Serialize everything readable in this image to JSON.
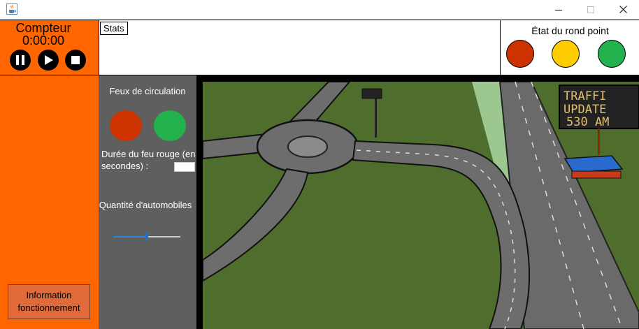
{
  "window": {
    "icon": "java-cup-icon",
    "controls": [
      "minimize-icon",
      "maximize-icon",
      "close-icon"
    ]
  },
  "counter": {
    "title": "Compteur",
    "time": "0:00:00",
    "buttons": [
      "pause-icon",
      "play-icon",
      "stop-icon"
    ]
  },
  "stats": {
    "tab_label": "Stats"
  },
  "roundabout_state": {
    "title": "État du rond point",
    "lights": [
      {
        "name": "red",
        "color": "#cc3300"
      },
      {
        "name": "yellow",
        "color": "#ffcc00"
      },
      {
        "name": "green",
        "color": "#22b14c"
      }
    ]
  },
  "traffic_lights": {
    "title": "Feux de circulation",
    "red_color": "#cc3300",
    "green_color": "#22b14c",
    "red_duration_label": "Durée du feu rouge (en secondes) :",
    "red_duration_value": ""
  },
  "car_quantity": {
    "label": "Quantité d'automobiles",
    "level": 0.5
  },
  "info_button": {
    "label": "Information fonctionnement"
  },
  "scene": {
    "sign_text": [
      "TRAFFI",
      "UPDATE",
      "530 AM"
    ]
  },
  "colors": {
    "accent_orange": "#ff6600",
    "panel_gray": "#5f5f5f",
    "grass": "#4a6b2a",
    "road": "#6d6d6d"
  }
}
